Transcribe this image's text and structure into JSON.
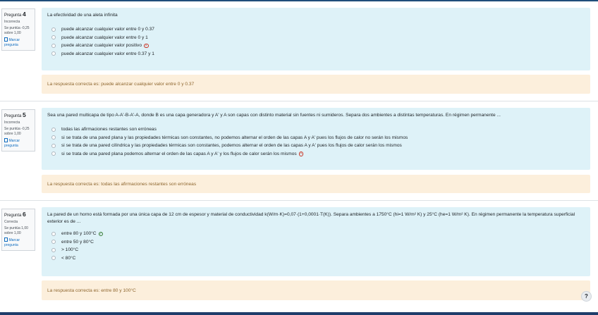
{
  "questions": [
    {
      "label": "Pregunta",
      "number": "4",
      "state": "Incorrecta",
      "grade": "Se puntúa -0,25 sobre 1,00",
      "flag_label": "Marcar pregunta",
      "text": "La efectividad de una aleta infinita",
      "answers": [
        {
          "text": "puede alcanzar cualquier valor entre 0 y 0.37",
          "mark": ""
        },
        {
          "text": "puede alcanzar cualquier valor entre 0 y 1",
          "mark": ""
        },
        {
          "text": "puede alcanzar cualquier valor positivo",
          "mark": "wrong"
        },
        {
          "text": "puede alcanzar cualquier valor entre 0.37 y 1",
          "mark": ""
        }
      ],
      "feedback": "La respuesta correcta es: puede alcanzar cualquier valor entre 0 y 0.37"
    },
    {
      "label": "Pregunta",
      "number": "5",
      "state": "Incorrecta",
      "grade": "Se puntúa -0,25 sobre 1,00",
      "flag_label": "Marcar pregunta",
      "text": "Sea una pared multicapa de tipo A-A'-B-A'-A, donde B es una capa generadora y A' y A son capas con distinto material sin fuentes ni sumideros. Separa dos ambientes a distintas temperaturas. En régimen permanente ...",
      "answers": [
        {
          "text": "todas las afirmaciones restantes son erróneas",
          "mark": ""
        },
        {
          "text": "si se trata de una pared plana y las propiedades térmicas son constantes, no podemos alternar el orden de las capas A y A' pues los flujos de calor no serán los mismos",
          "mark": ""
        },
        {
          "text": "si se trata de una pared cilíndrica y las propiedades térmicas son constantes, podemos alternar el orden de las capas A y A' pues los flujos de calor serán los mismos",
          "mark": ""
        },
        {
          "text": "si se trata de una pared plana podemos alternar el orden de las capas A y A' y los flujos de calor serán los mismos",
          "mark": "wrong"
        }
      ],
      "feedback": "La respuesta correcta es: todas las afirmaciones restantes son erróneas"
    },
    {
      "label": "Pregunta",
      "number": "6",
      "state": "Correcta",
      "grade": "Se puntúa 1,00 sobre 1,00",
      "flag_label": "Marcar pregunta",
      "text": "La pared de un horno está formada por una única capa de 12 cm de espesor y material de conductividad k(W/m·K)=0,07·(1+0,0001·T(K)). Separa ambientes a 1750°C (hi=1 W/m² K) y 25°C (he=1 W/m² K). En régimen permanente la temperatura superficial exterior es de ...",
      "answers": [
        {
          "text": "entre 80 y 100°C",
          "mark": "right"
        },
        {
          "text": "entre 50 y 80°C",
          "mark": ""
        },
        {
          "text": "> 100°C",
          "mark": ""
        },
        {
          "text": "< 80°C",
          "mark": ""
        }
      ],
      "feedback": "La respuesta correcta es: entre 80 y 100°C"
    }
  ],
  "help_label": "?",
  "icons": {
    "wrong": "×",
    "right": "✓"
  },
  "colors": {
    "question_bg": "#def2f8",
    "feedback_bg": "#fcefdc",
    "incorrect": "#ca3120",
    "correct": "#357a32",
    "link": "#0f6cbf"
  }
}
